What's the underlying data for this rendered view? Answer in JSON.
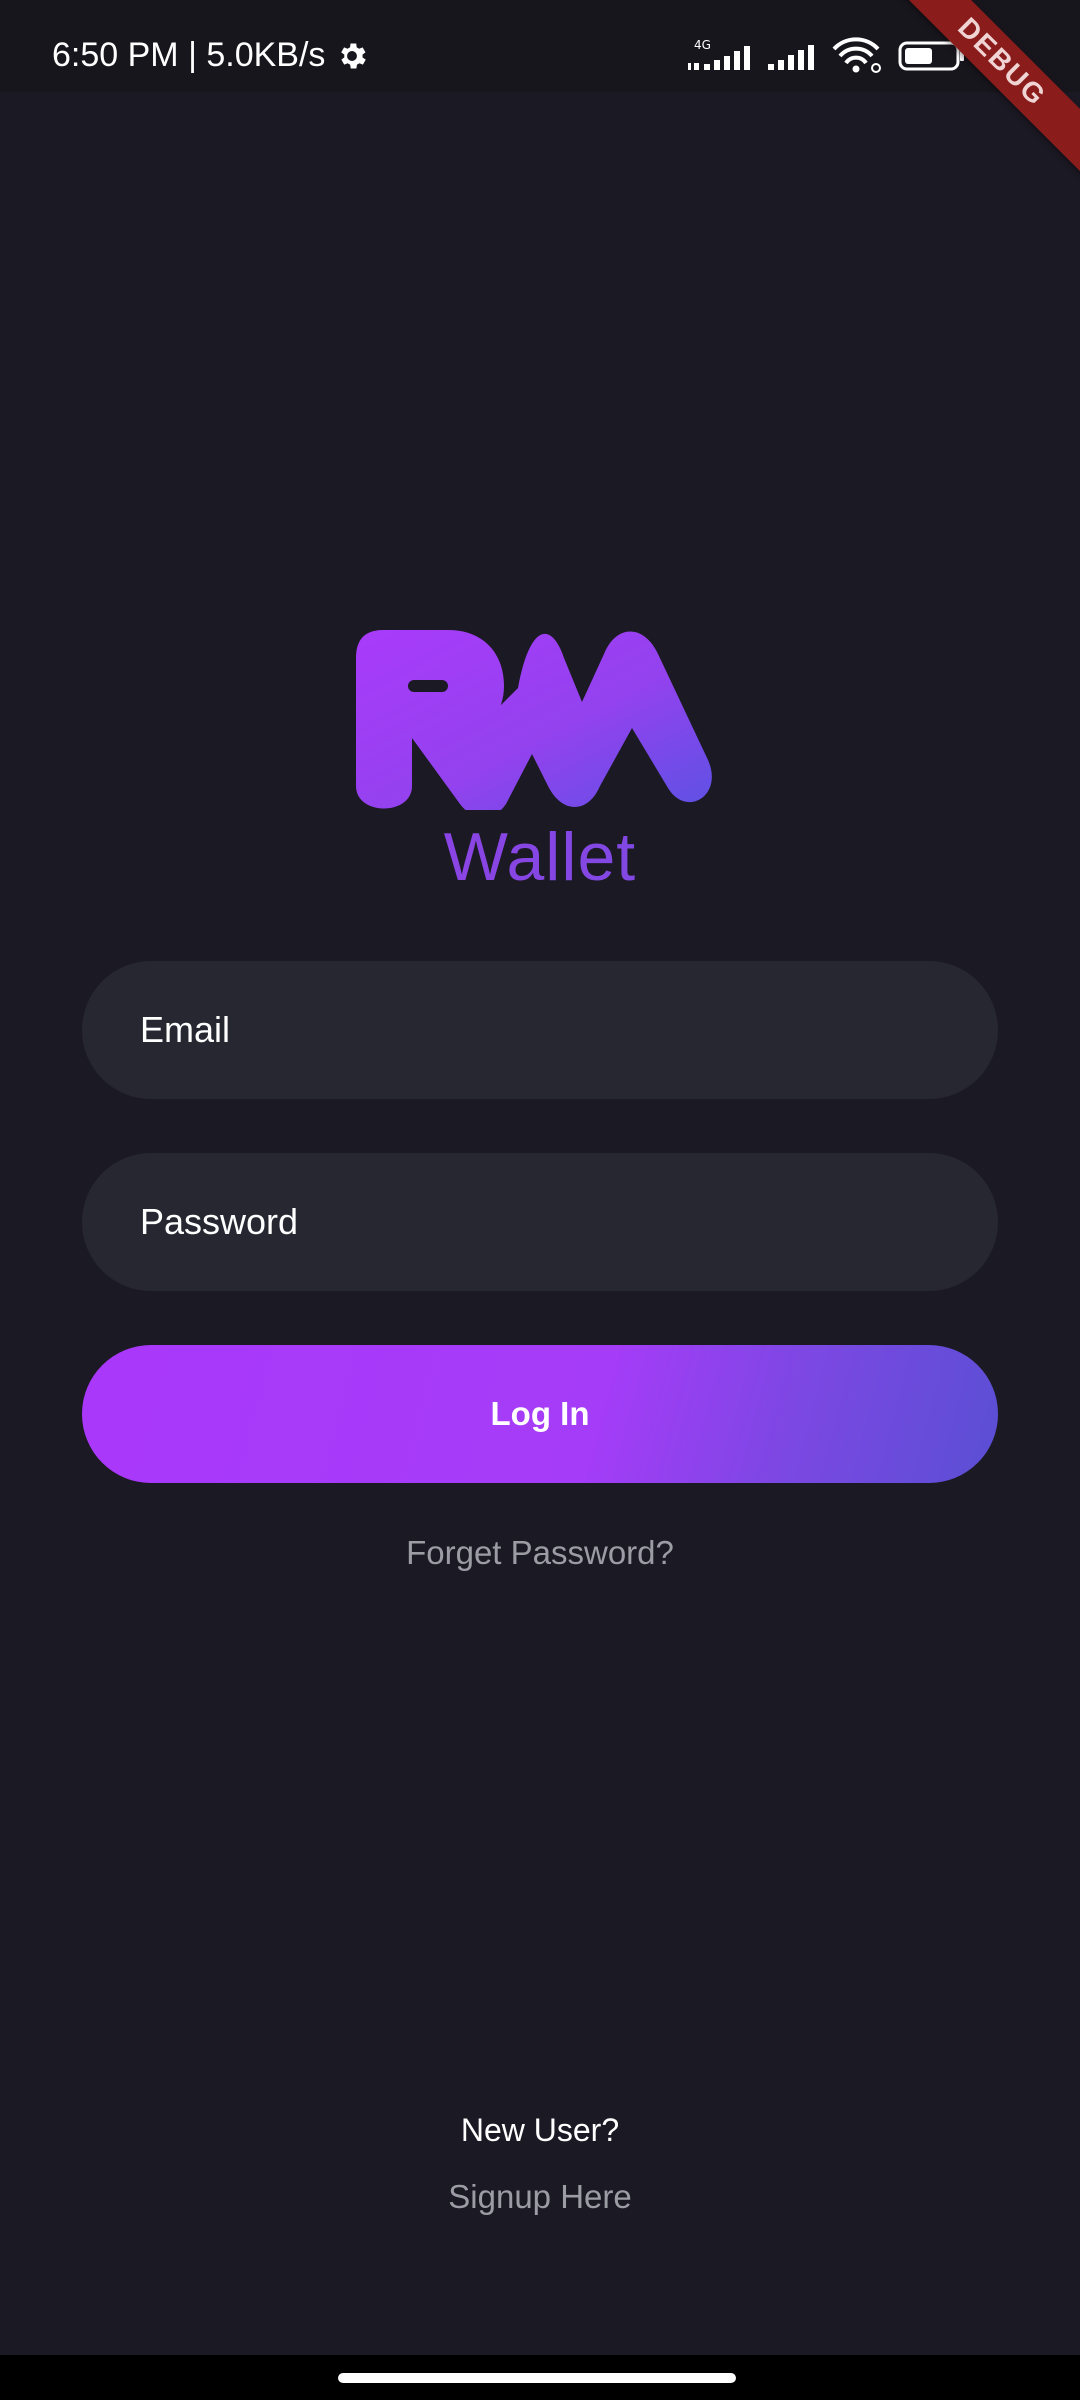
{
  "status_bar": {
    "time_speed": "6:50 PM | 5.0KB/s",
    "network_type": "4G",
    "battery": "52",
    "icons": [
      "gear-icon",
      "signal-4g-icon",
      "signal-icon",
      "wifi-icon",
      "battery-icon"
    ]
  },
  "debug_banner": "DEBUG",
  "app": {
    "logo_name": "RM",
    "wallet_label": "Wallet",
    "brand_colors": {
      "purple": "#AA38FB",
      "indigo": "#5A4FD4"
    }
  },
  "form": {
    "email_placeholder": "Email",
    "password_placeholder": "Password",
    "login_label": "Log In",
    "forgot_label": "Forget Password?"
  },
  "footer": {
    "new_user_label": "New User?",
    "signup_label": "Signup Here"
  }
}
